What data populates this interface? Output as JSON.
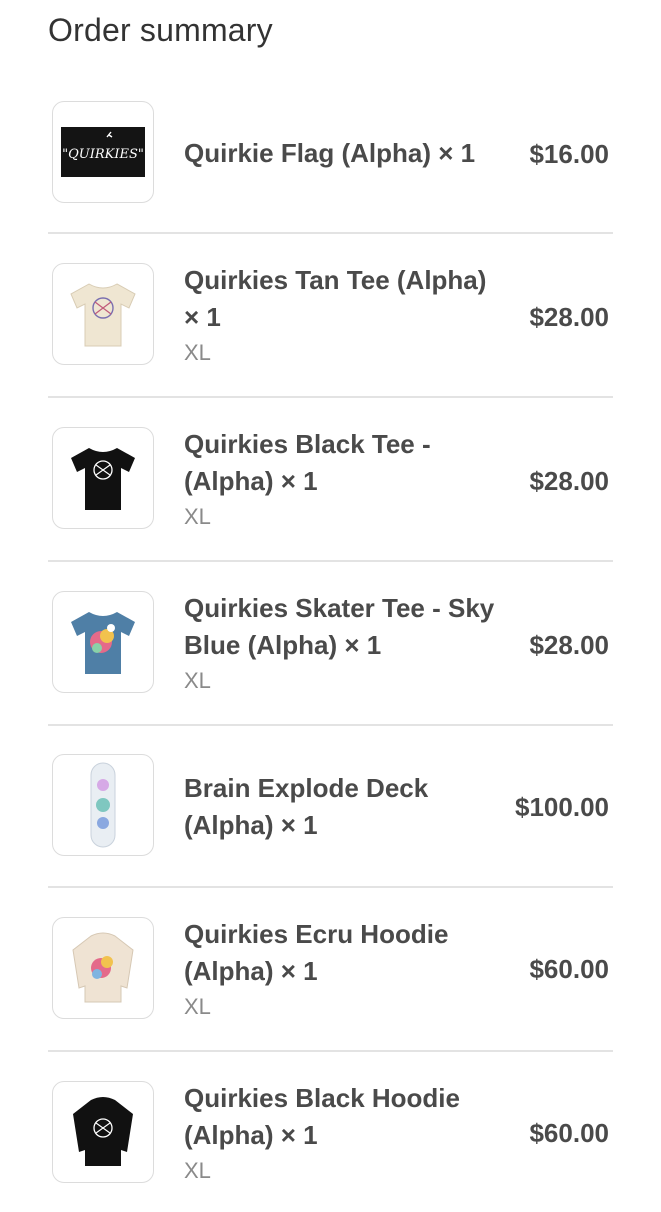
{
  "title": "Order summary",
  "items": [
    {
      "name": "Quirkie Flag (Alpha) × 1",
      "variant": "",
      "price": "$16.00",
      "thumb_text": "\"QUIRKIES\""
    },
    {
      "name": "Quirkies Tan Tee (Alpha) × 1",
      "variant": "XL",
      "price": "$28.00"
    },
    {
      "name": "Quirkies Black Tee - (Alpha) × 1",
      "variant": "XL",
      "price": "$28.00"
    },
    {
      "name": "Quirkies Skater Tee - Sky Blue (Alpha) × 1",
      "variant": "XL",
      "price": "$28.00"
    },
    {
      "name": "Brain Explode Deck (Alpha) × 1",
      "variant": "",
      "price": "$100.00"
    },
    {
      "name": "Quirkies Ecru Hoodie (Alpha) × 1",
      "variant": "XL",
      "price": "$60.00"
    },
    {
      "name": "Quirkies Black Hoodie (Alpha) × 1",
      "variant": "XL",
      "price": "$60.00"
    }
  ],
  "colors": {
    "tan": "#efe6d2",
    "black": "#111111",
    "sky_blue": "#4f7fa6",
    "ecru": "#efe3d3",
    "deck": "#e9eef3"
  }
}
